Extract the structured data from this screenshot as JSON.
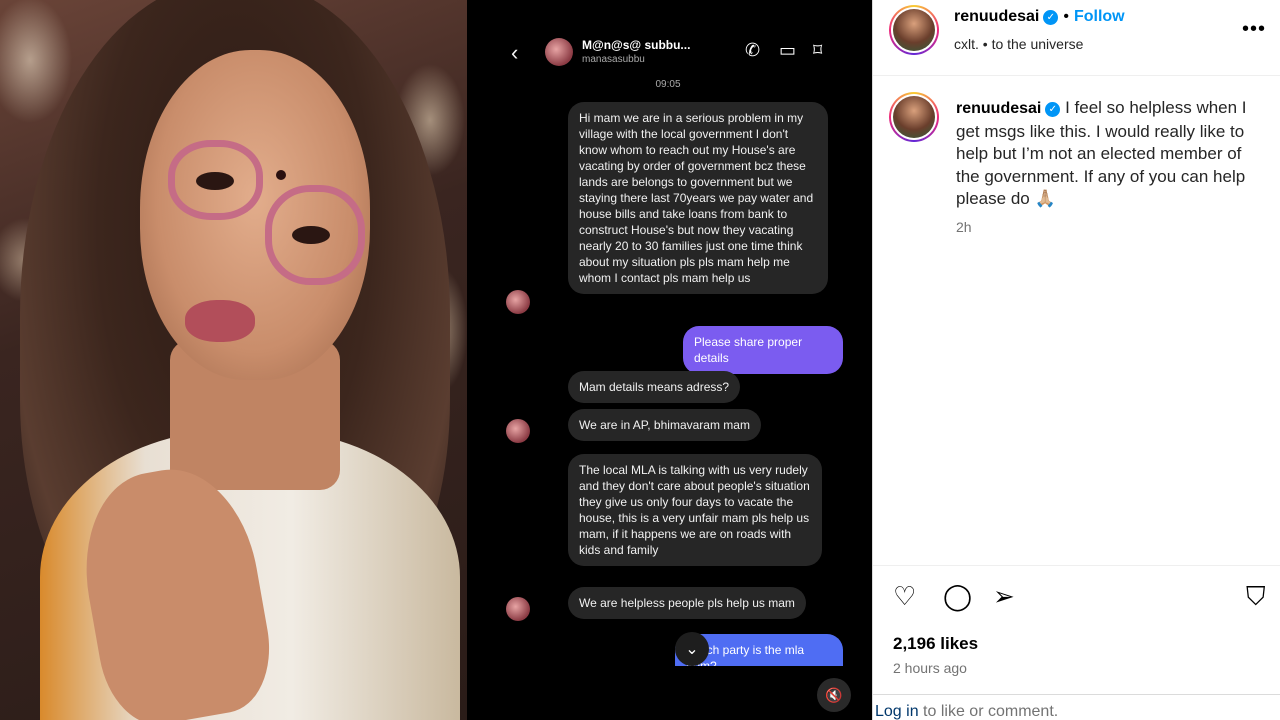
{
  "post_author": {
    "username": "renuudesai",
    "verified_icon": "verified-badge-icon",
    "follow_label": "Follow",
    "subtitle": "cxlt. • to the universe"
  },
  "caption": {
    "username": "renuudesai",
    "text": "I feel so helpless when I get msgs like this. I would really like to help but I’m not an elected member of the government. If any of you can help please do 🙏🏼",
    "time_ago": "2h"
  },
  "engagement": {
    "likes": "2,196 likes",
    "posted": "2 hours ago"
  },
  "footer": {
    "login": "Log in",
    "rest": "to like or comment."
  },
  "video": {
    "chat_name": "M@n@s@ subbu...",
    "chat_handle": "manasasubbu",
    "timestamp": "09:05",
    "messages": [
      {
        "from": "them",
        "text": "Hi mam we are in a serious problem in my village with the local government I don't know whom to reach out my House's are vacating by order of government bcz these lands are belongs to government but we staying there last 70years we pay water and house bills and take loans from bank to construct House's but now they vacating nearly 20 to 30 families just one time think about my situation pls pls mam help me whom I contact pls mam help us"
      },
      {
        "from": "me",
        "text": "Please share proper details"
      },
      {
        "from": "them",
        "text": "Mam details means adress?"
      },
      {
        "from": "them",
        "text": "We are in AP, bhimavaram mam"
      },
      {
        "from": "them",
        "text": "The local MLA is talking with us very rudely and they don't care about people's situation they give us only four days to vacate the house, this is a very unfair mam pls help us mam, if it happens we are on roads with kids and family"
      },
      {
        "from": "them",
        "text": "We are helpless people pls help us mam"
      },
      {
        "from": "me",
        "text": "Which party is the mla from?"
      }
    ]
  },
  "colors": {
    "accent": "#0095f6",
    "my_bubble": "#7b5cf0",
    "their_bubble": "#262626"
  }
}
